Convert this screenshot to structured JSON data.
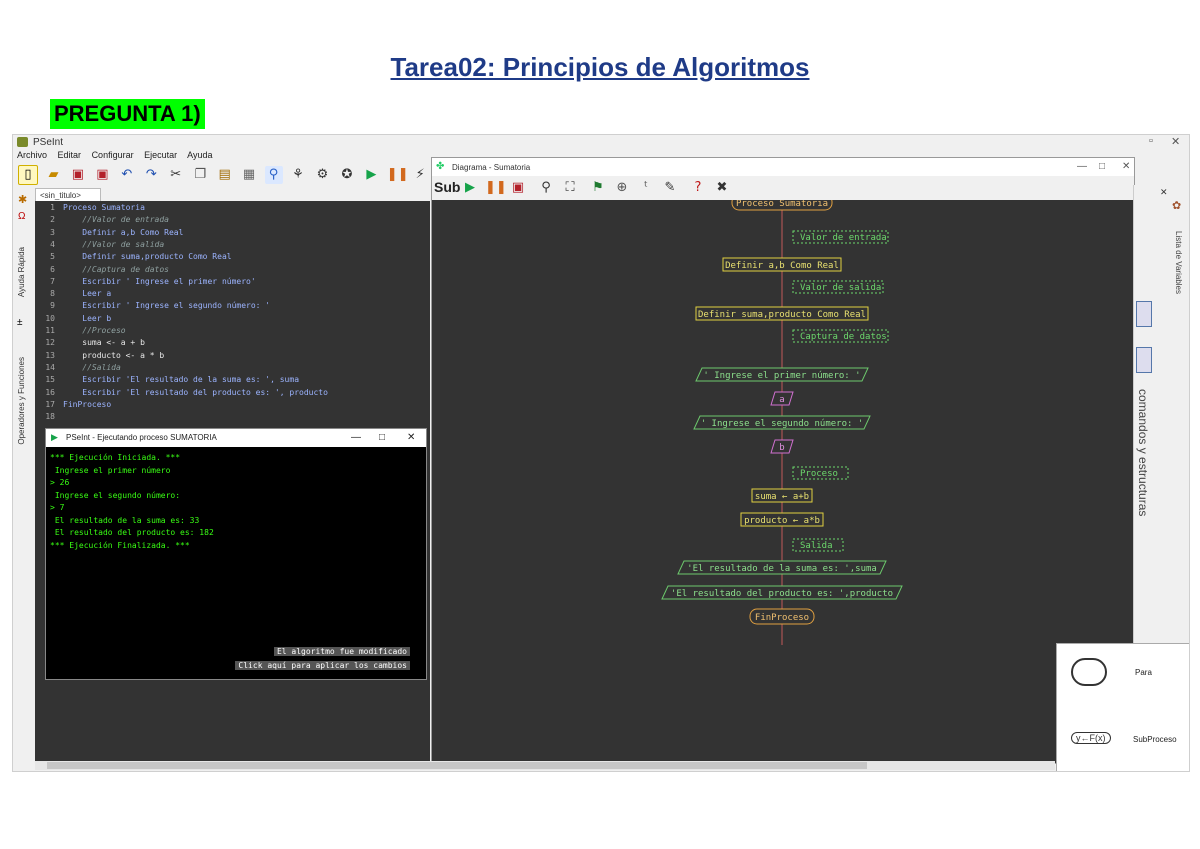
{
  "document": {
    "title": "Tarea02: Principios de Algoritmos",
    "question": "PREGUNTA 1)"
  },
  "app": {
    "window_title": "PSeInt",
    "menu": [
      "Archivo",
      "Editar",
      "Configurar",
      "Ejecutar",
      "Ayuda"
    ],
    "editor_tab": "<sin_titulo>",
    "left_vertical_labels": [
      "Ayuda Rápida",
      "Operadores y Funciones"
    ],
    "colors": {
      "editor_bg": "#333333",
      "accent_run": "#16a34a",
      "console_text": "#39ff14"
    }
  },
  "code": [
    {
      "n": "1",
      "t": "Proceso Sumatoria",
      "c": "kw"
    },
    {
      "n": "2",
      "t": "    //Valor de entrada",
      "c": "cm"
    },
    {
      "n": "3",
      "t": "    Definir a,b Como Real",
      "c": "kw"
    },
    {
      "n": "4",
      "t": "    //Valor de salida",
      "c": "cm"
    },
    {
      "n": "5",
      "t": "    Definir suma,producto Como Real",
      "c": "kw"
    },
    {
      "n": "6",
      "t": "    //Captura de datos",
      "c": "cm"
    },
    {
      "n": "7",
      "t": "    Escribir ' Ingrese el primer número'",
      "c": "kw"
    },
    {
      "n": "8",
      "t": "    Leer a",
      "c": "kw"
    },
    {
      "n": "9",
      "t": "    Escribir ' Ingrese el segundo número: '",
      "c": "kw"
    },
    {
      "n": "10",
      "t": "    Leer b",
      "c": "kw"
    },
    {
      "n": "11",
      "t": "    //Proceso",
      "c": "cm"
    },
    {
      "n": "12",
      "t": "    suma <- a + b",
      "c": "st"
    },
    {
      "n": "13",
      "t": "    producto <- a * b",
      "c": "st"
    },
    {
      "n": "14",
      "t": "    //Salida",
      "c": "cm"
    },
    {
      "n": "15",
      "t": "    Escribir 'El resultado de la suma es: ', suma",
      "c": "kw"
    },
    {
      "n": "16",
      "t": "    Escribir 'El resultado del producto es: ', producto",
      "c": "kw"
    },
    {
      "n": "17",
      "t": "FinProceso",
      "c": "kw"
    },
    {
      "n": "18",
      "t": "",
      "c": "st"
    }
  ],
  "console": {
    "title": "PSeInt - Ejecutando proceso SUMATORIA",
    "lines": [
      "*** Ejecución Iniciada. ***",
      " Ingrese el primer número",
      "> 26",
      " Ingrese el segundo número:",
      "> 7",
      " El resultado de la suma es: 33",
      " El resultado del producto es: 182",
      "*** Ejecución Finalizada. ***"
    ],
    "note_1": "El algoritmo fue modificado",
    "note_2": "Click aquí para aplicar los cambios"
  },
  "flowchart_window": {
    "title": "Diagrama - Sumatoria",
    "sub_label": "Sub",
    "nodes": {
      "start": "Proceso Sumatoria",
      "c1": "Valor de entrada",
      "d1": "Definir a,b Como Real",
      "c2": "Valor de salida",
      "d2": "Definir suma,producto Como Real",
      "c3": "Captura de datos",
      "w1": "' Ingrese el primer número: '",
      "r1": "a",
      "w2": "' Ingrese el segundo número: '",
      "r2": "b",
      "c4": "Proceso",
      "p1": "suma ← a+b",
      "p2": "producto ← a*b",
      "c5": "Salida",
      "w3": "'El resultado de la suma es: ',suma",
      "w4": "'El resultado del producto es: ',producto",
      "end": "FinProceso"
    }
  },
  "right_panel": {
    "side_label": "comandos y estructuras",
    "side_label_2": "Lista de Variables",
    "legend_1": "Para",
    "legend_2": "SubProceso",
    "legend_formula": "y←F(x)"
  }
}
